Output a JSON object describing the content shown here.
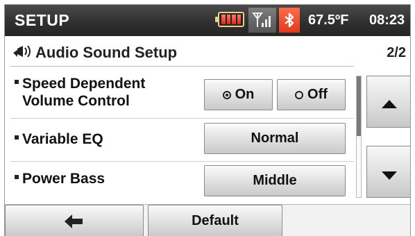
{
  "status_bar": {
    "title": "SETUP",
    "icons": [
      "battery-icon",
      "signal-icon",
      "bluetooth-icon"
    ],
    "temperature": "67.5ºF",
    "time": "08:23"
  },
  "header": {
    "icon": "speaker-icon",
    "title": "Audio Sound Setup",
    "page_indicator": "2/2"
  },
  "settings": [
    {
      "label_line1": "Speed Dependent",
      "label_line2": "Volume Control",
      "options": [
        {
          "label": "On",
          "selected": true
        },
        {
          "label": "Off",
          "selected": false
        }
      ]
    },
    {
      "label": "Variable EQ",
      "value": "Normal"
    },
    {
      "label": "Power Bass",
      "value": "Middle"
    }
  ],
  "scroll": {
    "up_icon": "triangle-up-icon",
    "down_icon": "triangle-down-icon",
    "thumb_position": 0.5
  },
  "footer": {
    "back_icon": "back-arrow-icon",
    "default_label": "Default"
  },
  "colors": {
    "status_bar_bg": "#2e2e2e",
    "bluetooth_bg": "#e03a1d",
    "button_face": "#e4e4e4"
  }
}
